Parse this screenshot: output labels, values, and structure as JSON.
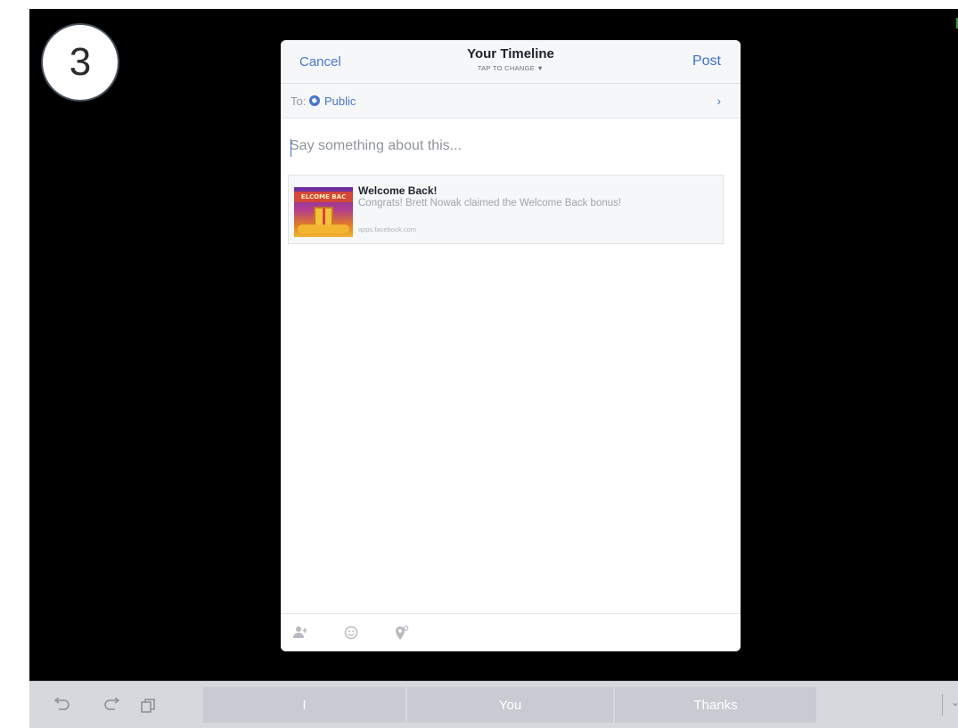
{
  "step_badge": {
    "number": "3"
  },
  "dialog": {
    "header": {
      "cancel_label": "Cancel",
      "title": "Your Timeline",
      "subtitle": "TAP TO CHANGE ▼",
      "post_label": "Post"
    },
    "audience": {
      "to_label": "To:",
      "value": "Public",
      "chevron": "›"
    },
    "composer": {
      "placeholder": "Say something about this..."
    },
    "link_card": {
      "thumb_text": "ELCOME BAC",
      "title": "Welcome Back!",
      "description": "Congrats! Brett Nowak claimed the Welcome Back bonus!",
      "domain": "apps.facebook.com"
    },
    "footer_icons": [
      "tag-people-icon",
      "emoji-icon",
      "location-icon"
    ]
  },
  "keyboard": {
    "icons": [
      "undo-icon",
      "redo-icon",
      "clipboard-icon"
    ],
    "suggestions": [
      "I",
      "You",
      "Thanks"
    ]
  },
  "colors": {
    "accent": "#4a76c7",
    "post": "#3b6fd0",
    "screen_bg": "#000000",
    "keyboard_bg": "#d5d8dd"
  }
}
